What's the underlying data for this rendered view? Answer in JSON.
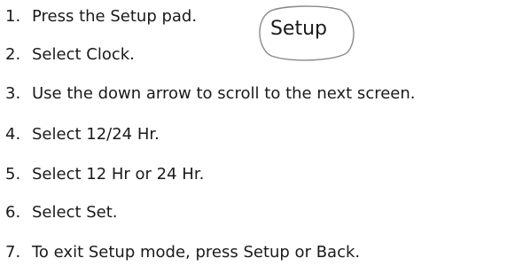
{
  "steps": [
    {
      "num": "1.",
      "text": "Press the Setup pad."
    },
    {
      "num": "2.",
      "text": "Select Clock."
    },
    {
      "num": "3.",
      "text": "Use the down arrow to scroll to the next screen."
    },
    {
      "num": "4.",
      "text": "Select 12/24 Hr."
    },
    {
      "num": "5.",
      "text": "Select 12 Hr or 24 Hr."
    },
    {
      "num": "6.",
      "text": "Select Set."
    },
    {
      "num": "7.",
      "text": "To exit Setup mode, press Setup or Back."
    }
  ],
  "setup_pad": {
    "label": "Setup"
  }
}
